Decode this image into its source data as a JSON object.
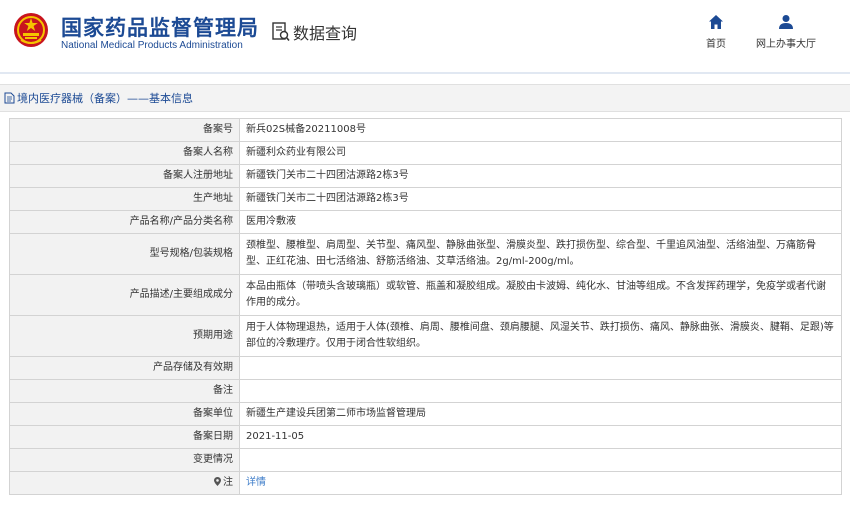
{
  "header": {
    "site_title": "国家药品监督管理局",
    "site_subtitle": "National Medical Products Administration",
    "query_label": "数据查询",
    "nav": [
      {
        "icon": "home-icon",
        "label": "首页"
      },
      {
        "icon": "user-icon",
        "label": "网上办事大厅"
      }
    ],
    "colors": {
      "brand": "#1c4a94",
      "link": "#3d7cc9",
      "label_bg": "#f2f2f2"
    }
  },
  "breadcrumb": {
    "icon": "document-icon",
    "text": "境内医疗器械（备案）——基本信息"
  },
  "rows": [
    {
      "label": "备案号",
      "value": "新兵02S械备20211008号"
    },
    {
      "label": "备案人名称",
      "value": "新疆利众药业有限公司"
    },
    {
      "label": "备案人注册地址",
      "value": "新疆铁门关市二十四团沽源路2栋3号"
    },
    {
      "label": "生产地址",
      "value": "新疆铁门关市二十四团沽源路2栋3号"
    },
    {
      "label": "产品名称/产品分类名称",
      "value": "医用冷敷液"
    },
    {
      "label": "型号规格/包装规格",
      "value": "颈椎型、腰椎型、肩周型、关节型、痛风型、静脉曲张型、滑膜炎型、跌打损伤型、综合型、千里追风油型、活络油型、万痛筋骨型、正红花油、田七活络油、舒筋活络油、艾草活络油。2g/ml-200g/ml。"
    },
    {
      "label": "产品描述/主要组成成分",
      "value": "本品由瓶体（带喷头含玻璃瓶）或软管、瓶盖和凝胶组成。凝胶由卡波姆、纯化水、甘油等组成。不含发挥药理学，免疫学或者代谢作用的成分。"
    },
    {
      "label": "预期用途",
      "value": "用于人体物理退热，适用于人体(颈椎、肩周、腰椎间盘、颈肩腰腿、风湿关节、跌打损伤、痛风、静脉曲张、滑膜炎、腱鞘、足跟)等部位的冷敷理疗。仅用于闭合性软组织。"
    },
    {
      "label": "产品存储及有效期",
      "value": ""
    },
    {
      "label": "备注",
      "value": ""
    },
    {
      "label": "备案单位",
      "value": "新疆生产建设兵团第二师市场监督管理局"
    },
    {
      "label": "备案日期",
      "value": "2021-11-05"
    },
    {
      "label": "变更情况",
      "value": ""
    },
    {
      "label": "注",
      "value": "详情",
      "icon": "pin-icon"
    }
  ]
}
